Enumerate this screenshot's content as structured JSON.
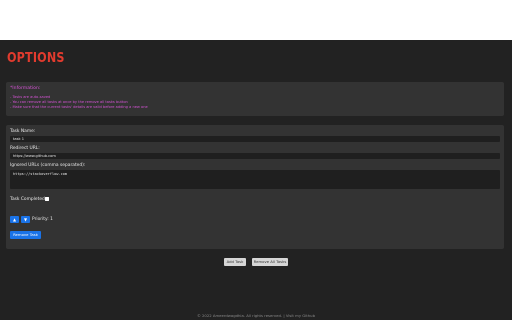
{
  "header": {
    "logo": "Options"
  },
  "info": {
    "title": "*Information:",
    "lines": [
      "- Tasks are auto-saved",
      "- You can remove all tasks at once by the remove all tasks button",
      "- Make sure that the current tasks' details are valid before adding a new one"
    ]
  },
  "task": {
    "name_label": "Task Name:",
    "name_value": "task 1",
    "url_label": "Redirect URL:",
    "url_value": "https://www.github.com",
    "ignored_label": "Ignored URLs (comma separated):",
    "ignored_value": "https://stackoverflow.com",
    "completed_label": "Task Completed:",
    "completed": false,
    "up_arrow": "▲",
    "down_arrow": "▼",
    "priority_label": "Priority: 1",
    "remove_label": "Remove Task"
  },
  "actions": {
    "add_label": "Add Task",
    "remove_all_label": "Remove All Tasks"
  },
  "footer": {
    "text": "© 2022 Ameerdwagdhia. All rights reserved. | Visit my Github"
  },
  "colors": {
    "accent_red": "#e23b2e",
    "info_text": "#d553d5",
    "primary_blue": "#1a73e8"
  }
}
